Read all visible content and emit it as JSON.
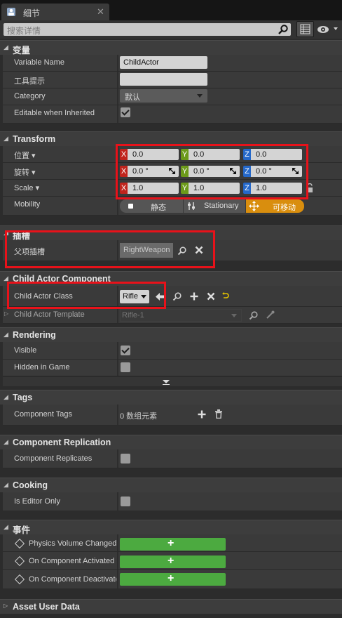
{
  "tab": {
    "title": "细节"
  },
  "search": {
    "placeholder": "搜索详情"
  },
  "sections": {
    "variable": {
      "title": "变量"
    },
    "transform": {
      "title": "Transform"
    },
    "socket": {
      "title": "插槽"
    },
    "child_actor": {
      "title": "Child Actor Component"
    },
    "rendering": {
      "title": "Rendering"
    },
    "tags": {
      "title": "Tags"
    },
    "replication": {
      "title": "Component Replication"
    },
    "cooking": {
      "title": "Cooking"
    },
    "events": {
      "title": "事件"
    },
    "asset_user_data": {
      "title": "Asset User Data"
    }
  },
  "variable": {
    "name_label": "Variable Name",
    "name_value": "ChildActor",
    "tooltip_label": "工具提示",
    "tooltip_value": "",
    "category_label": "Category",
    "category_value": "默认",
    "editable_label": "Editable when Inherited",
    "editable_checked": true
  },
  "transform": {
    "location_label": "位置",
    "rotation_label": "旋转",
    "scale_label": "Scale",
    "location": {
      "x": "0.0",
      "y": "0.0",
      "z": "0.0"
    },
    "rotation": {
      "x": "0.0 °",
      "y": "0.0 °",
      "z": "0.0 °"
    },
    "scale": {
      "x": "1.0",
      "y": "1.0",
      "z": "1.0"
    },
    "axis_x": "X",
    "axis_y": "Y",
    "axis_z": "Z",
    "mobility_label": "Mobility",
    "mobility_options": [
      "静态",
      "Stationary",
      "可移动"
    ],
    "mobility_selected": "可移动"
  },
  "socket": {
    "parent_socket_label": "父项插槽",
    "parent_socket_value": "RightWeapon"
  },
  "child_actor": {
    "class_label": "Child Actor Class",
    "class_value": "Rifle",
    "template_label": "Child Actor Template",
    "template_value": "Rifle-1"
  },
  "rendering": {
    "visible_label": "Visible",
    "visible_checked": true,
    "hidden_label": "Hidden in Game",
    "hidden_checked": false
  },
  "tags": {
    "label": "Component Tags",
    "value": "0 数组元素"
  },
  "replication": {
    "label": "Component Replicates",
    "checked": false
  },
  "cooking": {
    "label": "Is Editor Only",
    "checked": false
  },
  "events": [
    {
      "label": "Physics Volume Changed"
    },
    {
      "label": "On Component Activated"
    },
    {
      "label": "On Component Deactivated"
    }
  ],
  "colors": {
    "accent_orange": "#d98e0e",
    "add_green": "#4caa40",
    "highlight_red": "#e8121a"
  }
}
